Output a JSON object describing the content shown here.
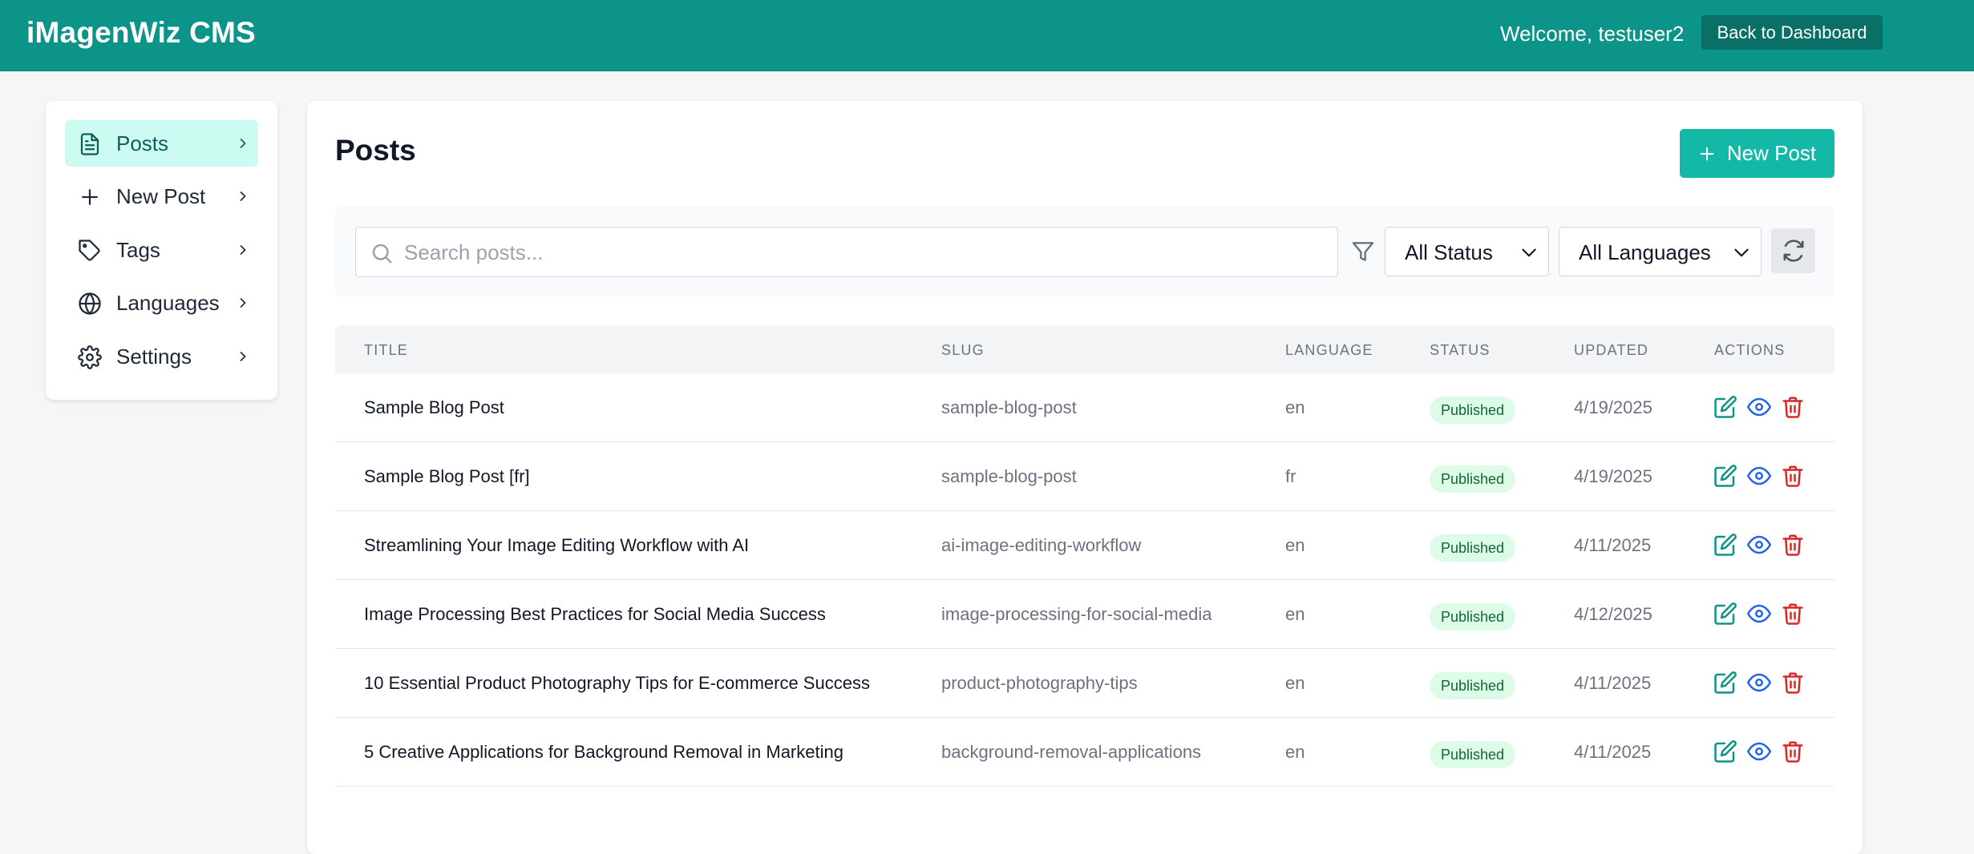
{
  "header": {
    "brand": "iMagenWiz CMS",
    "welcome": "Welcome, testuser2",
    "back_label": "Back to Dashboard",
    "color": "#0d9488"
  },
  "sidebar": {
    "items": [
      {
        "label": "Posts",
        "icon": "file-text-icon",
        "active": true
      },
      {
        "label": "New Post",
        "icon": "plus-icon",
        "active": false
      },
      {
        "label": "Tags",
        "icon": "tag-icon",
        "active": false
      },
      {
        "label": "Languages",
        "icon": "globe-icon",
        "active": false
      },
      {
        "label": "Settings",
        "icon": "gear-icon",
        "active": false
      }
    ]
  },
  "main": {
    "title": "Posts",
    "new_post_label": "New Post",
    "search_placeholder": "Search posts...",
    "status_filter": "All Status",
    "language_filter": "All Languages",
    "accent": "#14b8a6"
  },
  "table": {
    "columns": [
      "Title",
      "Slug",
      "Language",
      "Status",
      "Updated",
      "Actions"
    ],
    "rows": [
      {
        "title": "Sample Blog Post",
        "slug": "sample-blog-post",
        "language": "en",
        "status": "Published",
        "updated": "4/19/2025"
      },
      {
        "title": "Sample Blog Post [fr]",
        "slug": "sample-blog-post",
        "language": "fr",
        "status": "Published",
        "updated": "4/19/2025"
      },
      {
        "title": "Streamlining Your Image Editing Workflow with AI",
        "slug": "ai-image-editing-workflow",
        "language": "en",
        "status": "Published",
        "updated": "4/11/2025"
      },
      {
        "title": "Image Processing Best Practices for Social Media Success",
        "slug": "image-processing-for-social-media",
        "language": "en",
        "status": "Published",
        "updated": "4/12/2025"
      },
      {
        "title": "10 Essential Product Photography Tips for E-commerce Success",
        "slug": "product-photography-tips",
        "language": "en",
        "status": "Published",
        "updated": "4/11/2025"
      },
      {
        "title": "5 Creative Applications for Background Removal in Marketing",
        "slug": "background-removal-applications",
        "language": "en",
        "status": "Published",
        "updated": "4/11/2025"
      }
    ]
  }
}
